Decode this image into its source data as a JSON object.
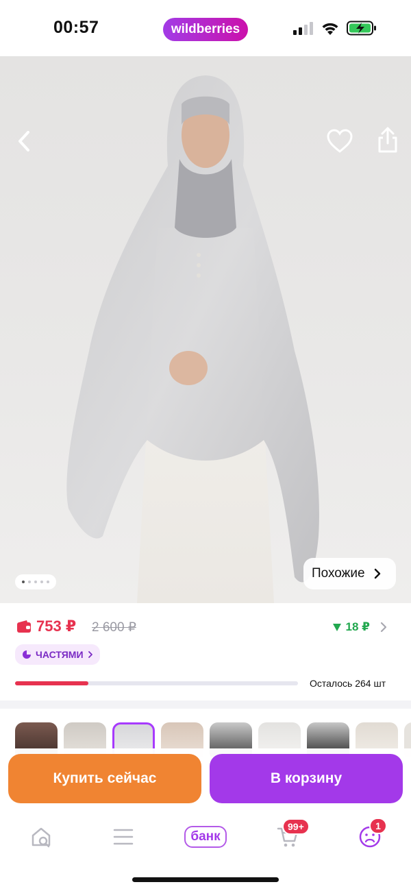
{
  "status_bar": {
    "time": "00:57",
    "brand": "wildberries"
  },
  "hero": {
    "icons": {
      "back": "chevron-left-icon",
      "favorite": "heart-icon",
      "share": "share-icon"
    },
    "gallery_dots": 5,
    "gallery_active_index": 0,
    "similar_label": "Похожие"
  },
  "price": {
    "current": "753 ₽",
    "old": "2 600 ₽",
    "cashback": "18 ₽",
    "installments_label": "ЧАСТЯМИ",
    "stock_text": "Осталось 264 шт",
    "stock_fraction": 0.26,
    "colors": {
      "price": "#e7324f",
      "cashback": "#22a84f",
      "accent": "#a339e9"
    }
  },
  "thumbnails": {
    "selected_index": 2,
    "items": [
      "dark-abaya",
      "beige-khimar",
      "grey-khimar",
      "beige-hijab",
      "black-khimar",
      "white-khimar",
      "black-hijab",
      "cream-hijab"
    ]
  },
  "actions": {
    "buy_now": "Купить сейчас",
    "add_to_cart": "В корзину",
    "buy_color": "#f08432",
    "cart_color": "#a339e9"
  },
  "tabbar": {
    "items": [
      {
        "name": "home-search",
        "icon": "home-search-icon"
      },
      {
        "name": "catalog",
        "icon": "menu-icon"
      },
      {
        "name": "bank",
        "label": "банк"
      },
      {
        "name": "cart",
        "icon": "cart-icon",
        "badge": "99+"
      },
      {
        "name": "profile",
        "icon": "profile-icon",
        "badge": "1"
      }
    ]
  }
}
